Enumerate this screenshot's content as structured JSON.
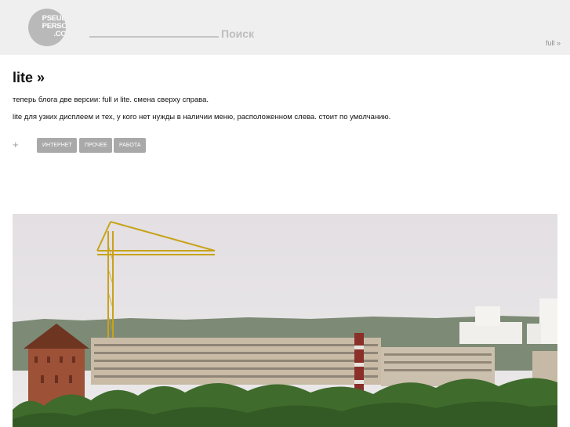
{
  "header": {
    "logo_line1": "PSEUDO",
    "logo_line2": "PERSON",
    "logo_line3": ".COM",
    "search_placeholder": "Поиск",
    "version_link": "full »"
  },
  "post": {
    "title": "lite »",
    "paragraphs": [
      "теперь блога две версии: full и lite. смена сверху справа.",
      "lite для узких дисплеем и тех, у кого нет нужды в наличии меню, расположенном слева. стоит по умолчанию."
    ],
    "add_symbol": "+",
    "tags": [
      "ИНТЕРНЕТ",
      "ПРОЧЕЕ",
      "РАБОТА"
    ]
  },
  "colors": {
    "header_bg": "#efefef",
    "logo_bg": "#b9b9b9",
    "tag_bg": "#a9a9a9"
  },
  "icons": {
    "add": "plus-icon"
  }
}
